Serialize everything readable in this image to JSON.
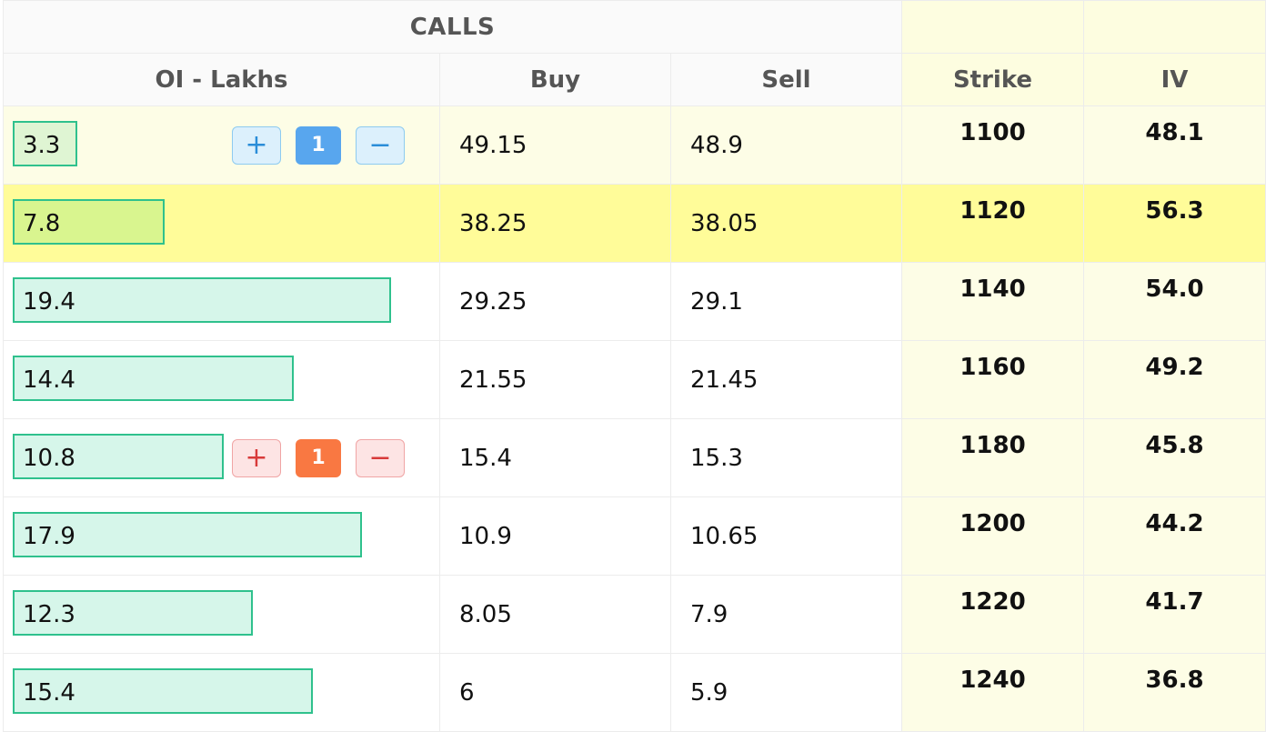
{
  "header": {
    "calls_label": "CALLS",
    "columns": {
      "oi": "OI - Lakhs",
      "buy": "Buy",
      "sell": "Sell",
      "strike": "Strike",
      "iv": "IV"
    }
  },
  "oi_max": 19.4,
  "rows": [
    {
      "oi": "3.3",
      "buy": "49.15",
      "sell": "48.9",
      "strike": "1100",
      "iv": "48.1",
      "qty": "1",
      "state": "itm",
      "order": "buy"
    },
    {
      "oi": "7.8",
      "buy": "38.25",
      "sell": "38.05",
      "strike": "1120",
      "iv": "56.3",
      "state": "atm"
    },
    {
      "oi": "19.4",
      "buy": "29.25",
      "sell": "29.1",
      "strike": "1140",
      "iv": "54.0",
      "state": "otm"
    },
    {
      "oi": "14.4",
      "buy": "21.55",
      "sell": "21.45",
      "strike": "1160",
      "iv": "49.2",
      "state": "otm"
    },
    {
      "oi": "10.8",
      "buy": "15.4",
      "sell": "15.3",
      "strike": "1180",
      "iv": "45.8",
      "qty": "1",
      "state": "otm",
      "order": "sell"
    },
    {
      "oi": "17.9",
      "buy": "10.9",
      "sell": "10.65",
      "strike": "1200",
      "iv": "44.2",
      "state": "otm"
    },
    {
      "oi": "12.3",
      "buy": "8.05",
      "sell": "7.9",
      "strike": "1220",
      "iv": "41.7",
      "state": "otm"
    },
    {
      "oi": "15.4",
      "buy": "6",
      "sell": "5.9",
      "strike": "1240",
      "iv": "36.8",
      "state": "otm"
    }
  ],
  "icons": {
    "plus": "+",
    "minus": "−"
  },
  "colors": {
    "oi_border": "#2fc18d",
    "atm_row": "#fffc99",
    "buy_qty": "#58a6ee",
    "sell_qty": "#f97842",
    "strike_band": "#fdfde6"
  }
}
